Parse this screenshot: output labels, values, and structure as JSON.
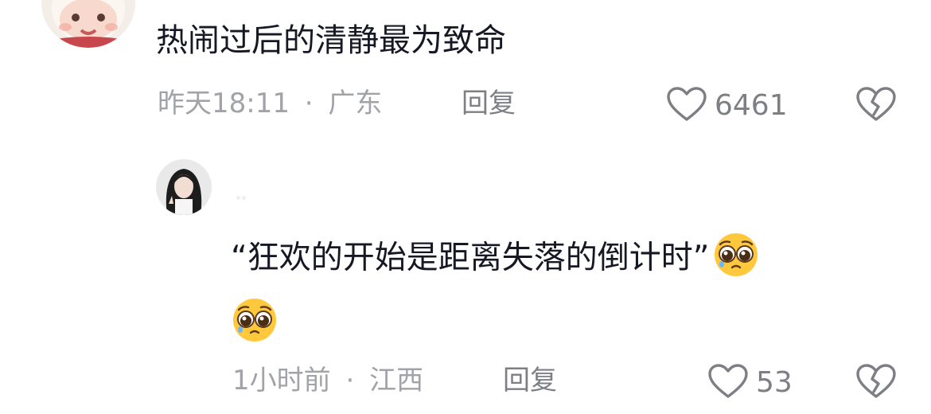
{
  "comments": [
    {
      "text": "热闹过后的清静最为致命",
      "time": "昨天18:11",
      "separator": "·",
      "location": "广东",
      "reply_label": "回复",
      "like_count": "6461"
    },
    {
      "username": "..",
      "text": "“狂欢的开始是距离失落的倒计时”",
      "time": "1小时前",
      "separator": "·",
      "location": "江西",
      "reply_label": "回复",
      "like_count": "53"
    }
  ],
  "icons": {
    "like": "heart-outline-icon",
    "dislike": "broken-heart-icon",
    "emoji": "pleading-face-emoji"
  },
  "colors": {
    "text": "#161823",
    "meta": "#a1a3a8",
    "action": "#7d7f85",
    "emoji_face": "#ffc83d"
  }
}
